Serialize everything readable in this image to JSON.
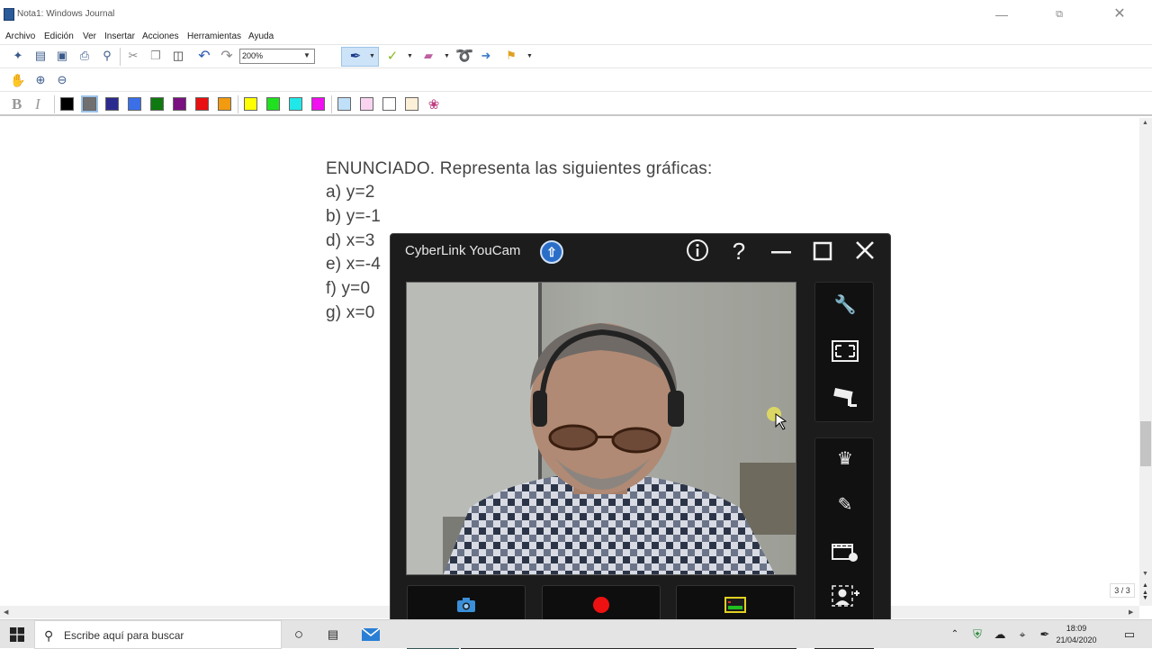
{
  "window": {
    "title": "Nota1: Windows Journal"
  },
  "menu": [
    "Archivo",
    "Edición",
    "Ver",
    "Insertar",
    "Acciones",
    "Herramientas",
    "Ayuda"
  ],
  "toolbar": {
    "zoom_value": "200%"
  },
  "palette": {
    "ink_colors": [
      "#000000",
      "#707070",
      "#2b2b8f",
      "#3a6fe8",
      "#0f7a0f",
      "#7a1080",
      "#e81010",
      "#f29a10"
    ],
    "highlighter_colors": [
      "#ffff00",
      "#20e020",
      "#20e8e8",
      "#f010f0"
    ],
    "light_colors": [
      "#bfe0f8",
      "#f8d4f0",
      "#ffffff",
      "#fdf0d8"
    ]
  },
  "document": {
    "lines": [
      "ENUNCIADO. Representa las siguientes gráficas:",
      "a) y=2",
      "b) y=-1",
      "d) x=3",
      "e) x=-4",
      "f) y=0",
      "g) x=0"
    ],
    "page_indicator": "3 / 3"
  },
  "youcam": {
    "title": "CyberLink YouCam"
  },
  "taskbar": {
    "search_placeholder": "Escribe aquí para buscar",
    "time": "18:09",
    "date": "21/04/2020"
  }
}
